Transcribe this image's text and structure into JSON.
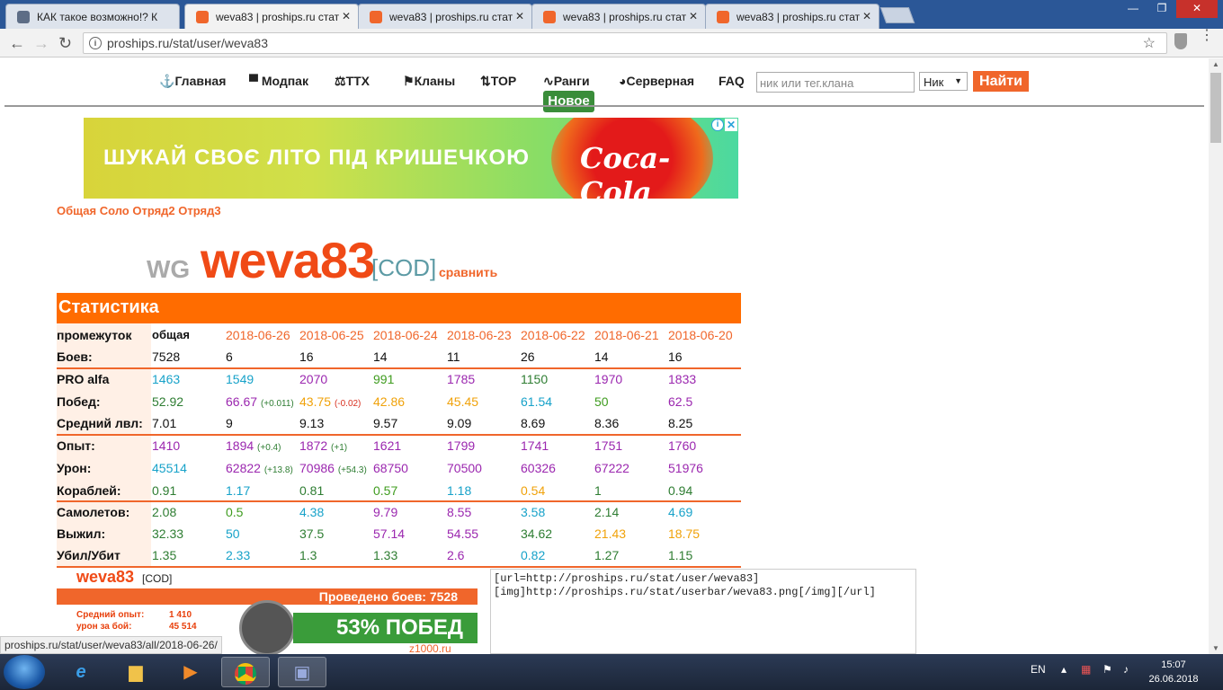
{
  "browser": {
    "tabs": [
      {
        "title": "КАК такое возможно!? К",
        "favicon": "ship-icon",
        "active": false
      },
      {
        "title": "weva83 | proships.ru стат",
        "favicon": "proships-icon",
        "active": true
      },
      {
        "title": "weva83 | proships.ru стат",
        "favicon": "proships-icon",
        "active": false
      },
      {
        "title": "weva83 | proships.ru стат",
        "favicon": "proships-icon",
        "active": false
      },
      {
        "title": "weva83 | proships.ru стат",
        "favicon": "proships-icon",
        "active": false
      }
    ],
    "url": "proships.ru/stat/user/weva83",
    "status_url": "proships.ru/stat/user/weva83/all/2018-06-26/"
  },
  "nav": {
    "items": [
      "Главная",
      "Модпак",
      "ТТХ",
      "Кланы",
      "TOP",
      "Ранги",
      "Серверная",
      "FAQ"
    ],
    "new_badge": "Новое",
    "search_placeholder": "ник или тег.клана",
    "select_value": "Ник",
    "search_button": "Найти"
  },
  "ad": {
    "slogan": "ШУКАЙ СВОЄ ЛІТО ПІД КРИШЕЧКОЮ",
    "brand": "Coca-Cola",
    "info": "i",
    "close": "✕"
  },
  "modes": "Общая Соло Отряд2 Отряд3",
  "player": {
    "server": "WG",
    "name": "weva83",
    "clan": "[COD]",
    "compare": "сравнить"
  },
  "stats": {
    "title": "Статистика",
    "period_label": "промежуток",
    "columns": [
      "общая",
      "2018-06-26",
      "2018-06-25",
      "2018-06-24",
      "2018-06-23",
      "2018-06-22",
      "2018-06-21",
      "2018-06-20"
    ],
    "rows": [
      {
        "label": "Боев:",
        "values": [
          {
            "v": "7528",
            "c": "black"
          },
          {
            "v": "6",
            "c": "black"
          },
          {
            "v": "16",
            "c": "black"
          },
          {
            "v": "14",
            "c": "black"
          },
          {
            "v": "11",
            "c": "black"
          },
          {
            "v": "26",
            "c": "black"
          },
          {
            "v": "14",
            "c": "black"
          },
          {
            "v": "16",
            "c": "black"
          }
        ]
      },
      {
        "label": "PRO alfa",
        "values": [
          {
            "v": "1463",
            "c": "blue"
          },
          {
            "v": "1549",
            "c": "blue"
          },
          {
            "v": "2070",
            "c": "purple"
          },
          {
            "v": "991",
            "c": "green"
          },
          {
            "v": "1785",
            "c": "purple"
          },
          {
            "v": "1150",
            "c": "dgreen"
          },
          {
            "v": "1970",
            "c": "purple"
          },
          {
            "v": "1833",
            "c": "purple"
          }
        ]
      },
      {
        "label": "Побед:",
        "values": [
          {
            "v": "52.92",
            "c": "dgreen"
          },
          {
            "v": "66.67",
            "c": "purple",
            "d": "(+0.011)",
            "dc": "dgreen"
          },
          {
            "v": "43.75",
            "c": "orange",
            "d": "(-0.02)",
            "dc": "red"
          },
          {
            "v": "42.86",
            "c": "orange"
          },
          {
            "v": "45.45",
            "c": "orange"
          },
          {
            "v": "61.54",
            "c": "blue"
          },
          {
            "v": "50",
            "c": "green"
          },
          {
            "v": "62.5",
            "c": "purple"
          }
        ]
      },
      {
        "label": "Средний лвл:",
        "values": [
          {
            "v": "7.01",
            "c": "black"
          },
          {
            "v": "9",
            "c": "black"
          },
          {
            "v": "9.13",
            "c": "black"
          },
          {
            "v": "9.57",
            "c": "black"
          },
          {
            "v": "9.09",
            "c": "black"
          },
          {
            "v": "8.69",
            "c": "black"
          },
          {
            "v": "8.36",
            "c": "black"
          },
          {
            "v": "8.25",
            "c": "black"
          }
        ]
      },
      {
        "label": "Опыт:",
        "values": [
          {
            "v": "1410",
            "c": "purple"
          },
          {
            "v": "1894",
            "c": "purple",
            "d": "(+0.4)",
            "dc": "dgreen"
          },
          {
            "v": "1872",
            "c": "purple",
            "d": "(+1)",
            "dc": "dgreen"
          },
          {
            "v": "1621",
            "c": "purple"
          },
          {
            "v": "1799",
            "c": "purple"
          },
          {
            "v": "1741",
            "c": "purple"
          },
          {
            "v": "1751",
            "c": "purple"
          },
          {
            "v": "1760",
            "c": "purple"
          }
        ]
      },
      {
        "label": "Урон:",
        "values": [
          {
            "v": "45514",
            "c": "blue"
          },
          {
            "v": "62822",
            "c": "purple",
            "d": "(+13.8)",
            "dc": "dgreen"
          },
          {
            "v": "70986",
            "c": "purple",
            "d": "(+54.3)",
            "dc": "dgreen"
          },
          {
            "v": "68750",
            "c": "purple"
          },
          {
            "v": "70500",
            "c": "purple"
          },
          {
            "v": "60326",
            "c": "purple"
          },
          {
            "v": "67222",
            "c": "purple"
          },
          {
            "v": "51976",
            "c": "purple"
          }
        ]
      },
      {
        "label": "Кораблей:",
        "values": [
          {
            "v": "0.91",
            "c": "dgreen"
          },
          {
            "v": "1.17",
            "c": "blue"
          },
          {
            "v": "0.81",
            "c": "dgreen"
          },
          {
            "v": "0.57",
            "c": "green"
          },
          {
            "v": "1.18",
            "c": "blue"
          },
          {
            "v": "0.54",
            "c": "orange"
          },
          {
            "v": "1",
            "c": "dgreen"
          },
          {
            "v": "0.94",
            "c": "dgreen"
          }
        ]
      },
      {
        "label": "Самолетов:",
        "values": [
          {
            "v": "2.08",
            "c": "dgreen"
          },
          {
            "v": "0.5",
            "c": "green"
          },
          {
            "v": "4.38",
            "c": "blue"
          },
          {
            "v": "9.79",
            "c": "purple"
          },
          {
            "v": "8.55",
            "c": "purple"
          },
          {
            "v": "3.58",
            "c": "blue"
          },
          {
            "v": "2.14",
            "c": "dgreen"
          },
          {
            "v": "4.69",
            "c": "blue"
          }
        ]
      },
      {
        "label": "Выжил:",
        "values": [
          {
            "v": "32.33",
            "c": "dgreen"
          },
          {
            "v": "50",
            "c": "blue"
          },
          {
            "v": "37.5",
            "c": "dgreen"
          },
          {
            "v": "57.14",
            "c": "purple"
          },
          {
            "v": "54.55",
            "c": "purple"
          },
          {
            "v": "34.62",
            "c": "dgreen"
          },
          {
            "v": "21.43",
            "c": "orange"
          },
          {
            "v": "18.75",
            "c": "orange"
          }
        ]
      },
      {
        "label": "Убил/Убит",
        "values": [
          {
            "v": "1.35",
            "c": "dgreen"
          },
          {
            "v": "2.33",
            "c": "blue"
          },
          {
            "v": "1.3",
            "c": "dgreen"
          },
          {
            "v": "1.33",
            "c": "dgreen"
          },
          {
            "v": "2.6",
            "c": "purple"
          },
          {
            "v": "0.82",
            "c": "blue"
          },
          {
            "v": "1.27",
            "c": "dgreen"
          },
          {
            "v": "1.15",
            "c": "dgreen"
          }
        ]
      }
    ]
  },
  "userbar": {
    "name": "weva83",
    "clan": "[COD]",
    "battles": "Проведено боев: 7528",
    "avg_exp_label": "Средний опыт:",
    "avg_exp": "1 410",
    "dmg_label": "урон за бой:",
    "dmg": "45 514",
    "wins": "53% ПОБЕД",
    "site": "z1000.ru"
  },
  "bbcode": "[url=http://proships.ru/stat/user/weva83]\n[img]http://proships.ru/stat/userbar/weva83.png[/img][/url]",
  "taskbar": {
    "lang": "EN",
    "time": "15:07",
    "date": "26.06.2018"
  },
  "colors": {
    "accent": "#f0662b",
    "header": "#ff6c00",
    "blue": "#17a2c9",
    "purple": "#9b27af",
    "green": "#3f9c1f",
    "orange": "#f0a20a",
    "dgreen": "#2e7d32"
  }
}
